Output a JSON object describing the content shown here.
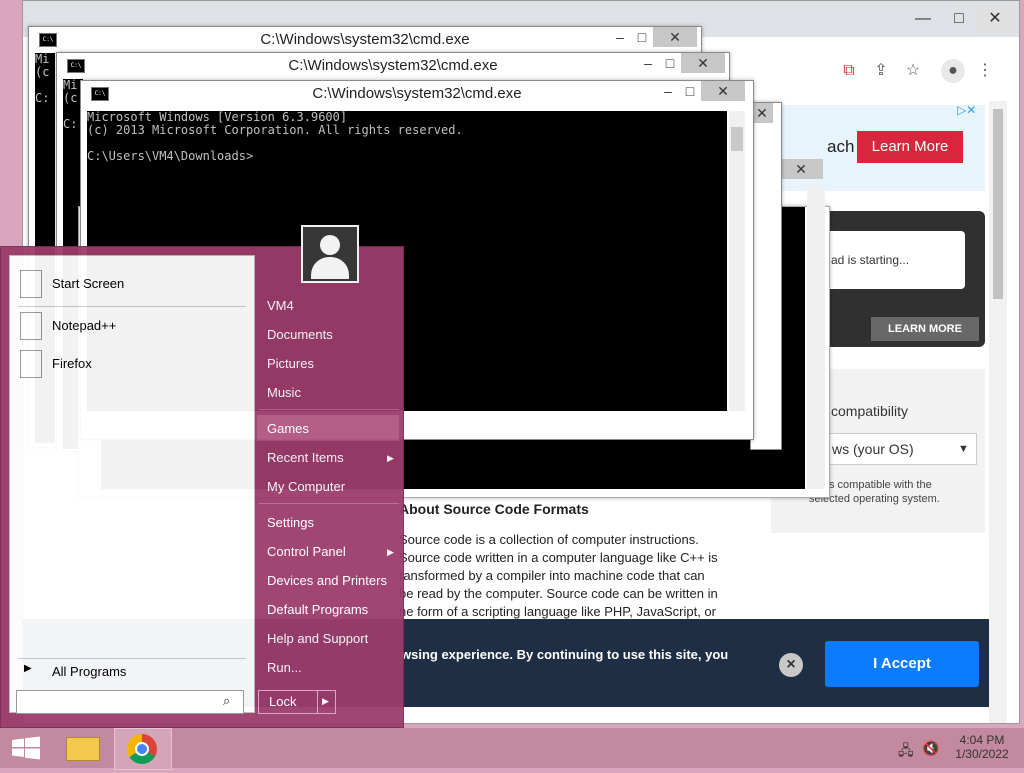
{
  "browser": {
    "ad_top": {
      "partial_text": "ach",
      "button": "Learn More",
      "adchoice": "▷✕"
    },
    "dark_ad": {
      "status": "ad is starting...",
      "button": "LEARN MORE"
    },
    "compat": {
      "title": "compatibility",
      "select": "ws (your OS)",
      "note_line1": "s compatible with the",
      "note_line2": "selected operating system."
    },
    "article": {
      "heading": "About Source Code Formats",
      "lines": [
        "Source code is a collection of computer instructions.",
        "Source code written in a computer language like C++ is",
        "ransformed by a compiler into machine code that can",
        "be read by the computer. Source code can be written in",
        "he form of a scripting language like PHP, JavaScript, or"
      ]
    },
    "cookie": {
      "text": "wsing experience. By continuing to use this site, you",
      "accept": "I Accept"
    }
  },
  "cmd_windows": [
    {
      "title": "C:\\Windows\\system32\\cmd.exe",
      "text": "Mi\n(c\n\nC:"
    },
    {
      "title": "C:\\Windows\\system32\\cmd.exe",
      "text": "Mi\n(c\n\nC:"
    },
    {
      "title": "C:\\Windows\\system32\\cmd.exe",
      "text": "Microsoft Windows [Version 6.3.9600]\n(c) 2013 Microsoft Corporation. All rights reserved.\n\nC:\\Users\\VM4\\Downloads>"
    }
  ],
  "start_menu": {
    "programs": {
      "start_screen": "Start Screen",
      "notepad": "Notepad++",
      "firefox": "Firefox",
      "all_programs": "All Programs"
    },
    "right": {
      "user": "VM4",
      "documents": "Documents",
      "pictures": "Pictures",
      "music": "Music",
      "games": "Games",
      "recent": "Recent Items",
      "computer": "My Computer",
      "settings": "Settings",
      "control": "Control Panel",
      "devices": "Devices and Printers",
      "default": "Default Programs",
      "help": "Help and Support",
      "run": "Run..."
    },
    "lock": "Lock"
  },
  "taskbar": {
    "time": "4:04 PM",
    "date": "1/30/2022"
  }
}
